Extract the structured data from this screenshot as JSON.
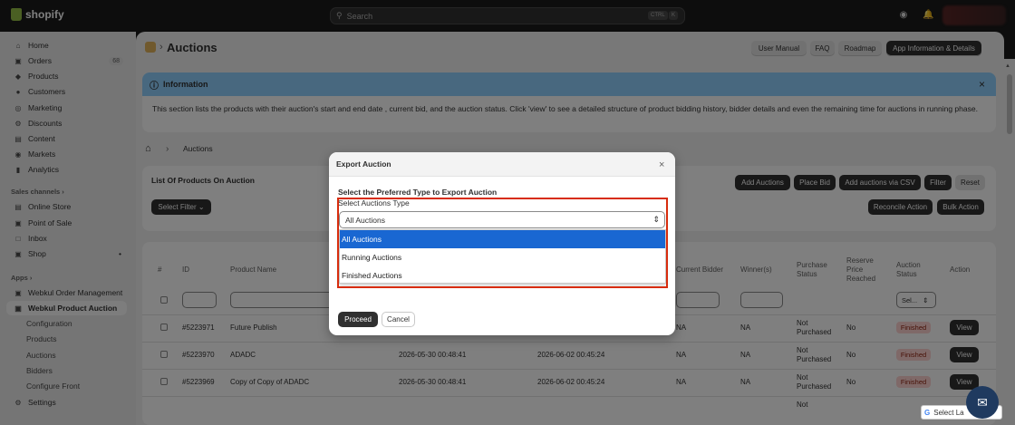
{
  "topbar": {
    "brand": "shopify",
    "search_placeholder": "Search",
    "kbd1": "CTRL",
    "kbd2": "K"
  },
  "sidebar": {
    "items": [
      {
        "label": "Home",
        "icon": "home-icon"
      },
      {
        "label": "Orders",
        "icon": "orders-icon",
        "badge": "68"
      },
      {
        "label": "Products",
        "icon": "tag-icon"
      },
      {
        "label": "Customers",
        "icon": "person-icon"
      },
      {
        "label": "Marketing",
        "icon": "target-icon"
      },
      {
        "label": "Discounts",
        "icon": "discount-icon"
      },
      {
        "label": "Content",
        "icon": "content-icon"
      },
      {
        "label": "Markets",
        "icon": "globe-icon"
      },
      {
        "label": "Analytics",
        "icon": "chart-icon"
      }
    ],
    "sales_channels_label": "Sales channels",
    "sales_channels": [
      {
        "label": "Online Store",
        "icon": "store-icon"
      },
      {
        "label": "Point of Sale",
        "icon": "pos-icon"
      },
      {
        "label": "Inbox",
        "icon": "inbox-icon"
      },
      {
        "label": "Shop",
        "icon": "shop-icon"
      }
    ],
    "apps_label": "Apps",
    "apps": [
      {
        "label": "Webkul Order Management"
      },
      {
        "label": "Webkul Product Auction"
      }
    ],
    "app_subitems": [
      "Configuration",
      "Products",
      "Auctions",
      "Bidders",
      "Configure Front"
    ],
    "settings_label": "Settings"
  },
  "header": {
    "title": "Auctions",
    "buttons": [
      "User Manual",
      "FAQ",
      "Roadmap",
      "App Information & Details"
    ]
  },
  "info": {
    "title": "Information",
    "body": "This section lists the products with their auction's start and end date , current bid, and the auction status. Click 'view' to see a detailed structure of product bidding history, bidder details and even the remaining time for auctions in running phase."
  },
  "breadcrumb": {
    "current": "Auctions"
  },
  "list_card": {
    "title": "List Of Products On Auction",
    "select_filter": "Select Filter",
    "buttons": [
      "Add Auctions",
      "Place Bid",
      "Add auctions via CSV",
      "Filter",
      "Reset"
    ],
    "buttons2": [
      "Reconcile Action",
      "Bulk Action"
    ]
  },
  "table": {
    "headers": {
      "hash": "#",
      "id": "ID",
      "product_name": "Product Name",
      "current_bidder": "Current Bidder",
      "winners": "Winner(s)",
      "purchase_status": "Purchase Status",
      "reserve_price": "Reserve Price Reached",
      "auction_status": "Auction Status",
      "action": "Action"
    },
    "status_filter": "Sel...",
    "rows": [
      {
        "id": "#5223971",
        "name": "Future Publish",
        "start": "",
        "end": "",
        "bidder": "NA",
        "winner": "NA",
        "purchase": "Not Purchased",
        "reserve": "No",
        "status": "Finished",
        "action": "View"
      },
      {
        "id": "#5223970",
        "name": "ADADC",
        "start": "2026-05-30 00:48:41",
        "end": "2026-06-02 00:45:24",
        "bidder": "NA",
        "winner": "NA",
        "purchase": "Not Purchased",
        "reserve": "No",
        "status": "Finished",
        "action": "View"
      },
      {
        "id": "#5223969",
        "name": "Copy of Copy of ADADC",
        "start": "2026-05-30 00:48:41",
        "end": "2026-06-02 00:45:24",
        "bidder": "NA",
        "winner": "NA",
        "purchase": "Not Purchased",
        "reserve": "No",
        "status": "Finished",
        "action": "View"
      }
    ],
    "partial_row_purchase": "Not"
  },
  "modal": {
    "title": "Export Auction",
    "question": "Select the Preferred Type to Export Auction",
    "select_label": "Select Auctions Type",
    "selected_value": "All Auctions",
    "options": [
      "All Auctions",
      "Running Auctions",
      "Finished Auctions"
    ],
    "proceed": "Proceed",
    "cancel": "Cancel"
  },
  "google_translate": "Select La",
  "colors": {
    "info_header": "#91d0ff",
    "selected_option": "#1967d2",
    "highlight_box": "#d72c0d",
    "status_badge": "#fed3d1"
  }
}
